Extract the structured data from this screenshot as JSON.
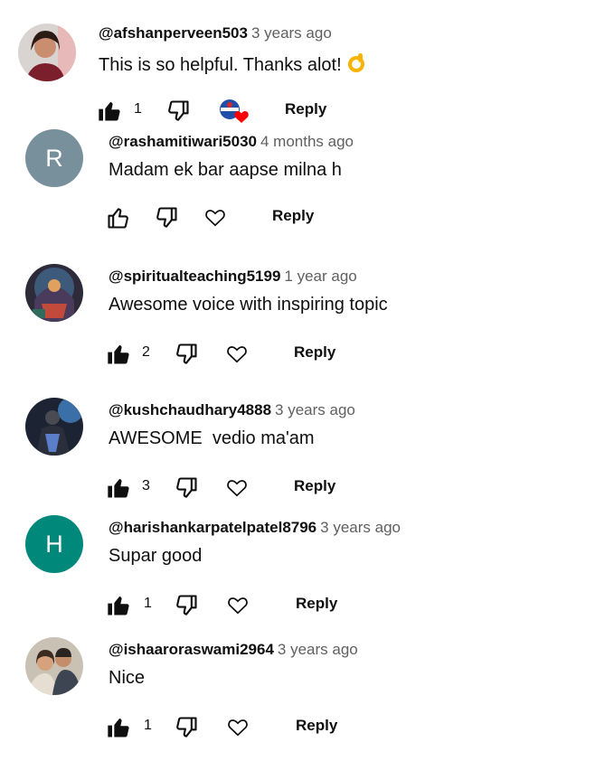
{
  "colors": {
    "like_filled": "#0f0f0f",
    "heart_red": "#ff0000",
    "time_gray": "#606060"
  },
  "icons": {
    "like": "thumbs-up-icon",
    "dislike": "thumbs-down-icon",
    "heart": "heart-icon"
  },
  "comments": [
    {
      "handle": "@afshanperveen503",
      "time": "3 years ago",
      "text": "This is so helpful. Thanks alot!",
      "emoji": "ok-hand-emoji",
      "likes": "1",
      "reply": "Reply",
      "creator_hearted": true,
      "avatar": "photo"
    },
    {
      "handle": "@rashamitiwari5030",
      "time": "4 months ago",
      "text": "Madam ek bar aapse milna h",
      "likes": "",
      "reply": "Reply",
      "avatar_letter": "R",
      "avatar_color": "#78909c"
    },
    {
      "handle": "@spiritualteaching5199",
      "time": "1 year ago",
      "text": "Awesome voice with inspiring topic",
      "likes": "2",
      "reply": "Reply",
      "avatar": "photo"
    },
    {
      "handle": "@kushchaudhary4888",
      "time": "3 years ago",
      "text": "AWESOME  vedio ma'am",
      "likes": "3",
      "reply": "Reply",
      "avatar": "photo"
    },
    {
      "handle": "@harishankarpatelpatel8796",
      "time": "3 years ago",
      "text": "Supar good",
      "likes": "1",
      "reply": "Reply",
      "avatar_letter": "H",
      "avatar_color": "#00897b"
    },
    {
      "handle": "@ishaaroraswami2964",
      "time": "3 years ago",
      "text": "Nice",
      "likes": "1",
      "reply": "Reply",
      "avatar": "photo"
    }
  ]
}
